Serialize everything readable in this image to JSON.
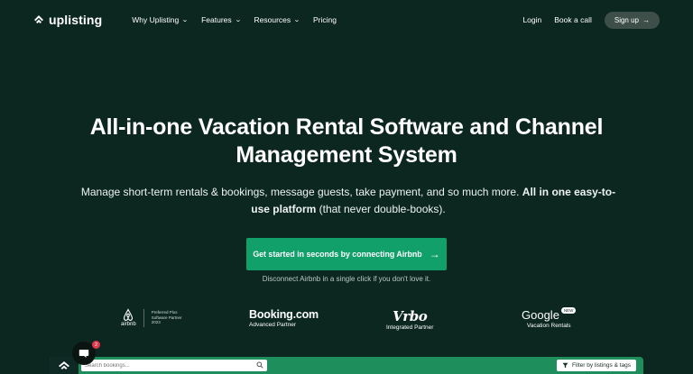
{
  "brand": {
    "name": "uplisting"
  },
  "nav": {
    "menu": [
      {
        "label": "Why Uplisting",
        "chevron": true
      },
      {
        "label": "Features",
        "chevron": true
      },
      {
        "label": "Resources",
        "chevron": true
      },
      {
        "label": "Pricing",
        "chevron": false
      }
    ],
    "login": "Login",
    "book_call": "Book a call",
    "signup": "Sign up",
    "signup_arrow": "→"
  },
  "hero": {
    "title_line1": "All-in-one Vacation Rental Software and Channel",
    "title_line2": "Management System",
    "sub_plain": "Manage short-term rentals & bookings, message guests, take payment, and so much more.",
    "sub_bold": "All in one easy-to-use platform",
    "sub_end": "(that never double-books).",
    "cta_label": "Get started in seconds by connecting Airbnb",
    "cta_arrow": "→",
    "cta_note": "Disconnect Airbnb in a single click if you don't love it."
  },
  "partners": {
    "airbnb": {
      "name": "airbnb",
      "badge_l1": "Preferred Plus",
      "badge_l2": "Software Partner",
      "badge_l3": "2023"
    },
    "booking": {
      "name": "Booking.com",
      "sub": "Advanced Partner"
    },
    "vrbo": {
      "name": "Vrbo",
      "sub": "Integrated Partner"
    },
    "google": {
      "name": "Google",
      "badge": "NEW",
      "sub": "Vacation Rentals"
    }
  },
  "preview": {
    "search_placeholder": "Search bookings...",
    "filter_label": "Filter by listings & tags"
  },
  "chat": {
    "badge_count": "2"
  },
  "colors": {
    "background": "#0c2720",
    "cta": "#12a06a",
    "preview": "#1e8e5c",
    "badge": "#e2374c"
  },
  "icons": [
    "uplisting-logo-icon",
    "chevron-down-icon",
    "arrow-right-icon",
    "airbnb-logo-icon",
    "search-icon",
    "filter-icon",
    "chat-icon"
  ]
}
